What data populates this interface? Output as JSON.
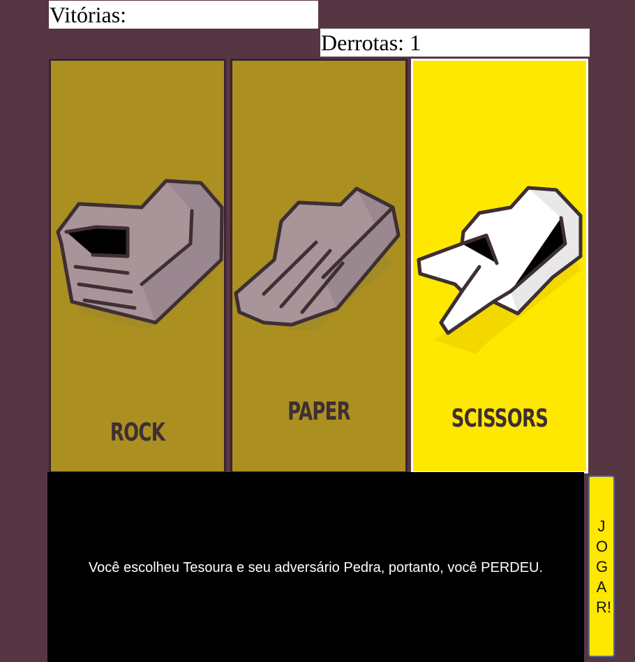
{
  "score": {
    "wins_text": "Vitórias:",
    "losses_text": "Derrotas: 1"
  },
  "choices": [
    {
      "id": "rock",
      "label": "ROCK",
      "icon": "rock-hand-icon",
      "selected": false
    },
    {
      "id": "paper",
      "label": "PAPER",
      "icon": "paper-hand-icon",
      "selected": false
    },
    {
      "id": "scissors",
      "label": "SCISSORS",
      "icon": "scissors-hand-icon",
      "selected": true
    }
  ],
  "result": {
    "message": "Você escolheu Tesoura e seu adversário Pedra, portanto, você PERDEU."
  },
  "play_button": {
    "label": "JOGAR!"
  },
  "colors": {
    "background": "#573644",
    "card_default": "#ab8f20",
    "card_selected": "#ffe800",
    "hand_default": "#a99499",
    "hand_selected": "#ffffff",
    "outline": "#3e2f33",
    "result_panel": "#000000",
    "play_button": "#ffe800"
  }
}
